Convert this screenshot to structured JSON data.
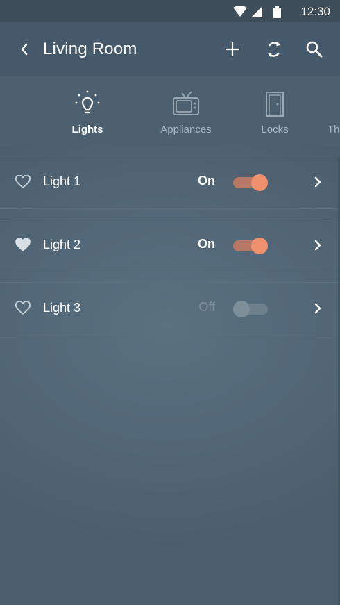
{
  "status": {
    "time": "12:30"
  },
  "header": {
    "title": "Living Room"
  },
  "tabs": [
    {
      "label": "",
      "icon": "device-icon"
    },
    {
      "label": "Lights",
      "icon": "lightbulb-icon",
      "active": true
    },
    {
      "label": "Appliances",
      "icon": "tv-icon"
    },
    {
      "label": "Locks",
      "icon": "door-icon"
    },
    {
      "label": "Th",
      "icon": ""
    }
  ],
  "devices": [
    {
      "name": "Light 1",
      "state": "On",
      "on": true,
      "favorite": false
    },
    {
      "name": "Light 2",
      "state": "On",
      "on": true,
      "favorite": true
    },
    {
      "name": "Light 3",
      "state": "Off",
      "on": false,
      "favorite": false
    }
  ],
  "colors": {
    "accent": "#ef916c",
    "appbar": "#46596a",
    "background": "#536878"
  }
}
